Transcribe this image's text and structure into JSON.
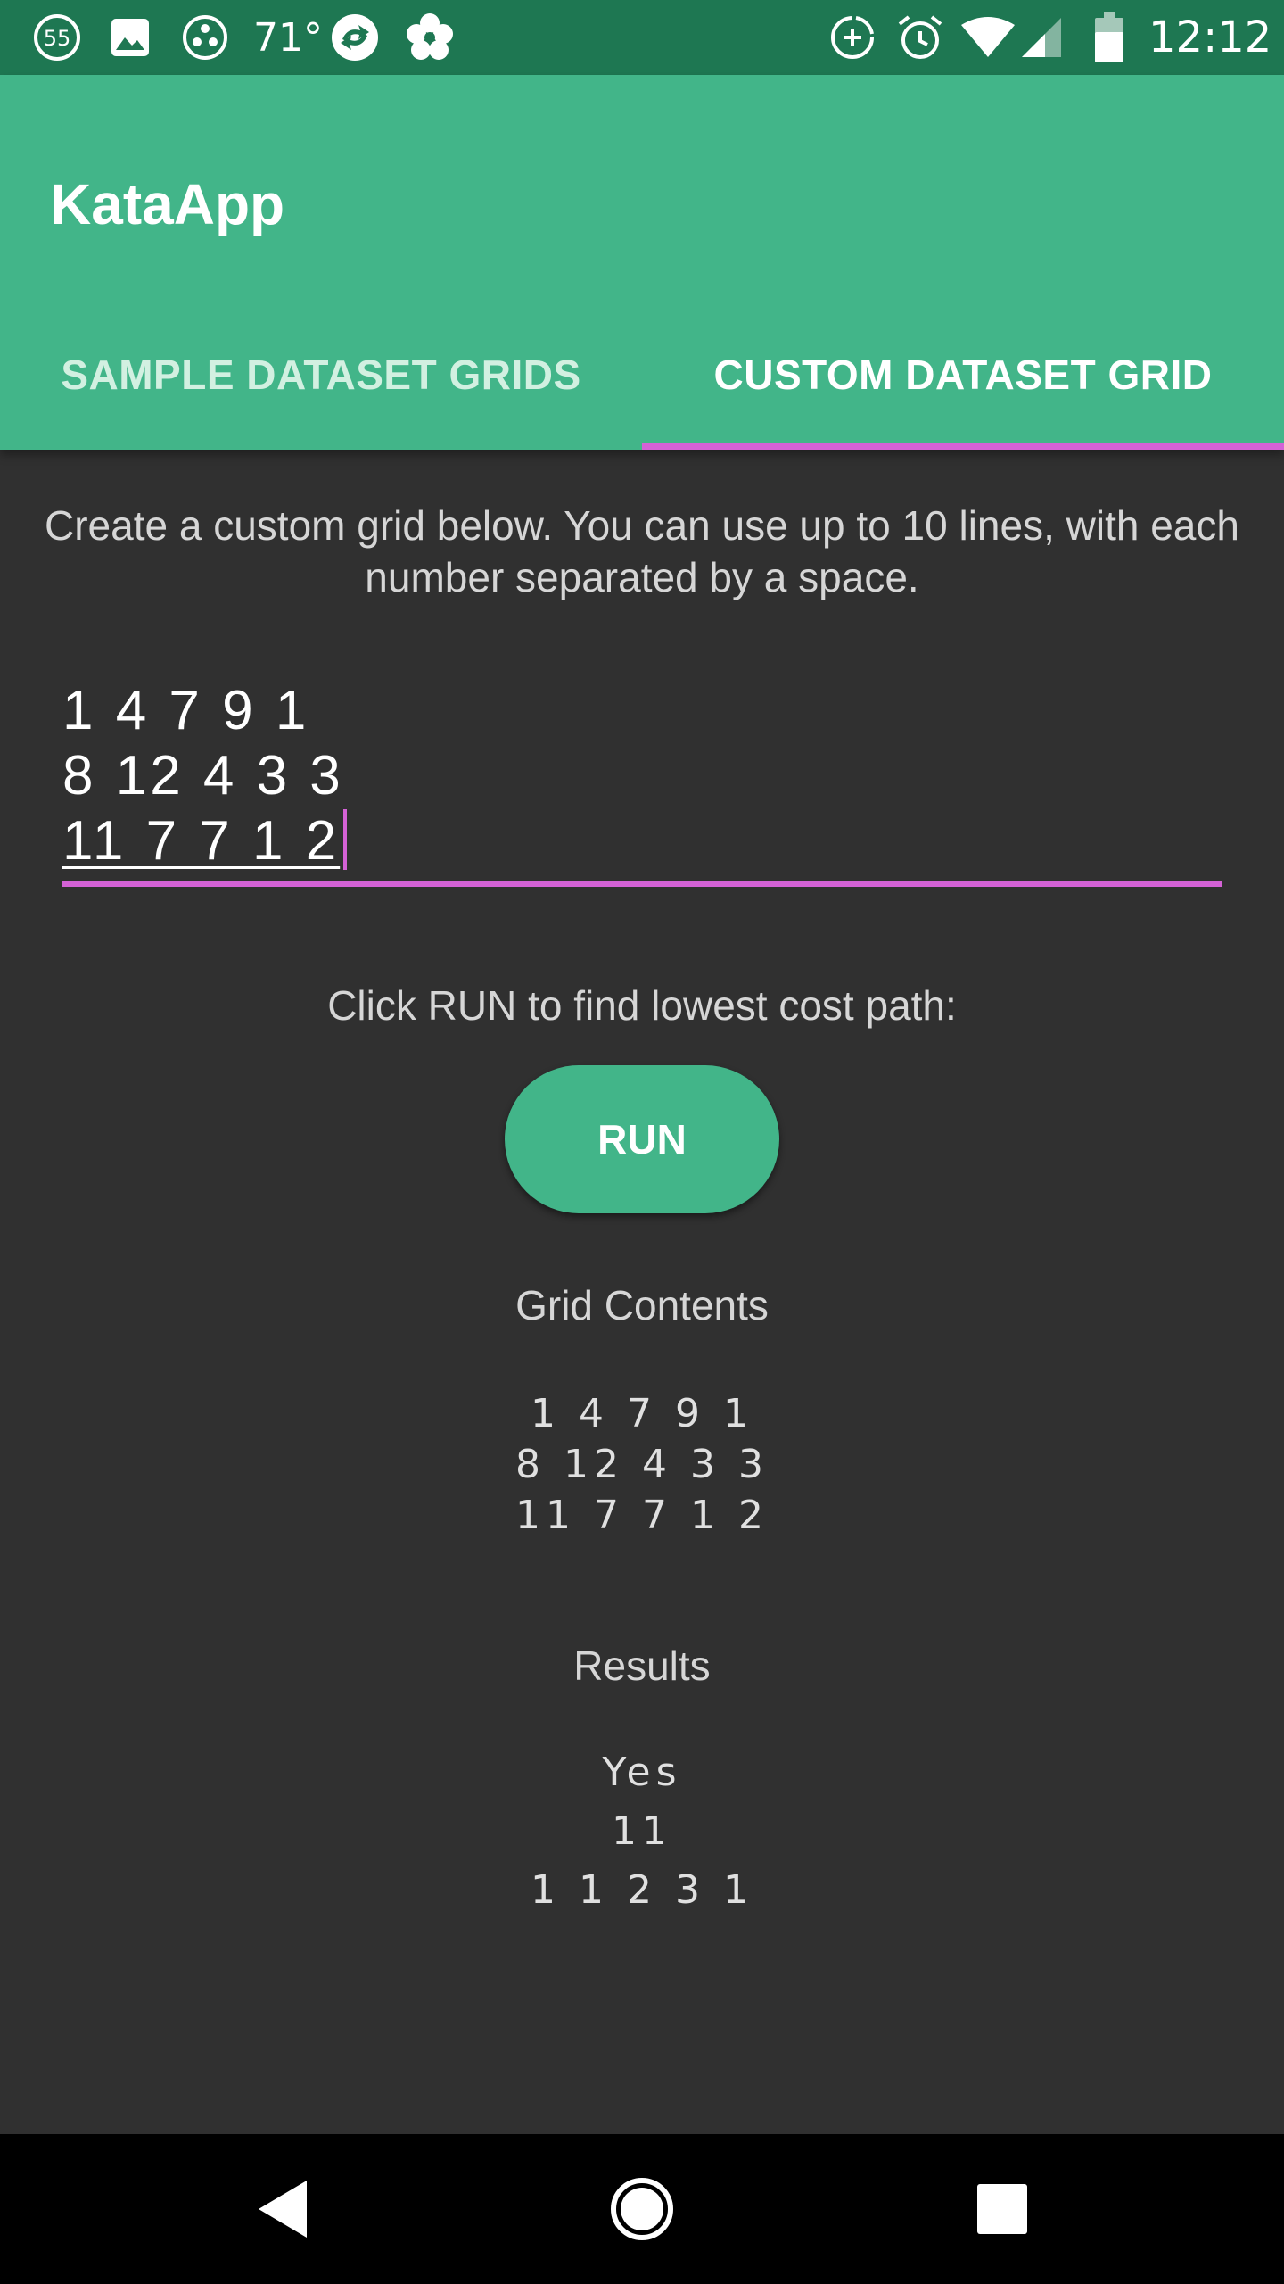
{
  "status_bar": {
    "notification_count": "55",
    "temperature": "71°",
    "time": "12:12",
    "icons": [
      "badge-55-icon",
      "image-icon",
      "dots-circle-icon",
      "weather-icon",
      "sync-icon",
      "flower-icon",
      "data-saver-icon",
      "alarm-icon",
      "wifi-icon",
      "signal-icon",
      "battery-icon"
    ]
  },
  "app": {
    "title": "KataApp",
    "colors": {
      "status_bar": "#1e7752",
      "primary": "#42b589",
      "accent": "#d462d6",
      "background": "#303030"
    }
  },
  "tabs": [
    {
      "label": "SAMPLE DATASET GRIDS",
      "active": false
    },
    {
      "label": "CUSTOM DATASET GRID",
      "active": true
    }
  ],
  "main": {
    "instructions": "Create a custom grid below. You can use up to 10 lines, with each number separated by a space.",
    "grid_input": {
      "lines": [
        "1 4 7 9 1",
        "8 12 4 3 3",
        "11 7 7 1 2"
      ]
    },
    "run_prompt": "Click RUN to find lowest cost path:",
    "run_label": "RUN",
    "grid_contents": {
      "heading": "Grid Contents",
      "lines": [
        "1 4 7 9 1",
        "8 12 4 3 3",
        "11 7 7 1 2"
      ]
    },
    "results": {
      "heading": "Results",
      "lines": [
        "Yes",
        "11",
        "1 1 2 3 1"
      ]
    }
  },
  "nav_bar": {
    "buttons": [
      "back-icon",
      "home-icon",
      "recents-icon"
    ]
  }
}
